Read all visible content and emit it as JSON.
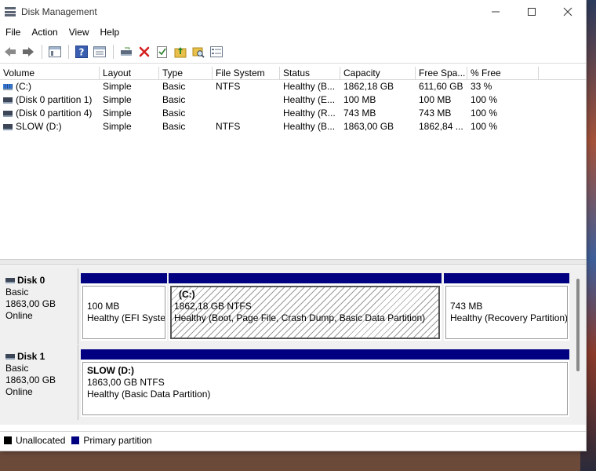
{
  "window": {
    "title": "Disk Management"
  },
  "menu": [
    "File",
    "Action",
    "View",
    "Help"
  ],
  "columns": [
    "Volume",
    "Layout",
    "Type",
    "File System",
    "Status",
    "Capacity",
    "Free Spa...",
    "% Free"
  ],
  "volumes": [
    {
      "volume": "(C:)",
      "layout": "Simple",
      "type": "Basic",
      "fs": "NTFS",
      "status": "Healthy (B...",
      "capacity": "1862,18 GB",
      "free": "611,60 GB",
      "pct": "33 %"
    },
    {
      "volume": "(Disk 0 partition 1)",
      "layout": "Simple",
      "type": "Basic",
      "fs": "",
      "status": "Healthy (E...",
      "capacity": "100 MB",
      "free": "100 MB",
      "pct": "100 %"
    },
    {
      "volume": "(Disk 0 partition 4)",
      "layout": "Simple",
      "type": "Basic",
      "fs": "",
      "status": "Healthy (R...",
      "capacity": "743 MB",
      "free": "743 MB",
      "pct": "100 %"
    },
    {
      "volume": "SLOW (D:)",
      "layout": "Simple",
      "type": "Basic",
      "fs": "NTFS",
      "status": "Healthy (B...",
      "capacity": "1863,00 GB",
      "free": "1862,84 ...",
      "pct": "100 %"
    }
  ],
  "disks": [
    {
      "name": "Disk 0",
      "kind": "Basic",
      "size": "1863,00 GB",
      "state": "Online",
      "partitions": [
        {
          "title": "",
          "size": "100 MB",
          "status": "Healthy (EFI System Partition)"
        },
        {
          "title": "(C:)",
          "size": "1862,18 GB NTFS",
          "status": "Healthy (Boot, Page File, Crash Dump, Basic Data Partition)"
        },
        {
          "title": "",
          "size": "743 MB",
          "status": "Healthy (Recovery Partition)"
        }
      ]
    },
    {
      "name": "Disk 1",
      "kind": "Basic",
      "size": "1863,00 GB",
      "state": "Online",
      "partitions": [
        {
          "title": "SLOW  (D:)",
          "size": "1863,00 GB NTFS",
          "status": "Healthy (Basic Data Partition)"
        }
      ]
    }
  ],
  "legend": [
    {
      "label": "Unallocated",
      "color": "#000000"
    },
    {
      "label": "Primary partition",
      "color": "#000080"
    }
  ],
  "colors": {
    "primary": "#000080",
    "unallocated": "#000000"
  }
}
